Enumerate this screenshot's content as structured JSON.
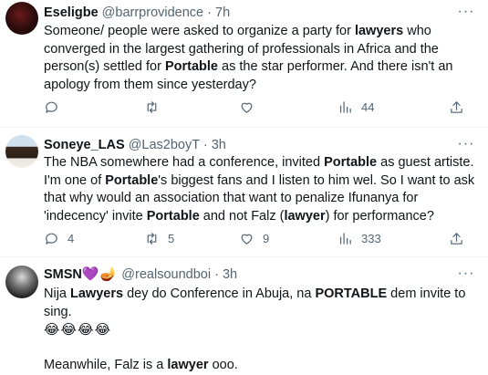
{
  "tweets": [
    {
      "name": "Eseligbe",
      "handle": "@barrprovidence",
      "separator": "·",
      "time": "7h",
      "more": "···",
      "lines": [
        [
          [
            "Someone/ people were asked to organize a party for ",
            false
          ],
          [
            "lawyers",
            true
          ],
          [
            " who",
            false
          ]
        ],
        [
          [
            "converged in the largest gathering of professionals in Africa and the",
            false
          ]
        ],
        [
          [
            "person(s) settled for ",
            false
          ],
          [
            "Portable",
            true
          ],
          [
            " as the star performer. And there isn't an",
            false
          ]
        ],
        [
          [
            "apology from them since yesterday?",
            false
          ]
        ]
      ],
      "counts": {
        "reply": "",
        "retweet": "",
        "like": "",
        "views": "44"
      }
    },
    {
      "name": "Soneye_LAS",
      "handle": "@Las2boyT",
      "separator": "·",
      "time": "3h",
      "more": "···",
      "lines": [
        [
          [
            "The NBA somewhere had a conference, invited ",
            false
          ],
          [
            "Portable",
            true
          ],
          [
            " as guest artiste.",
            false
          ]
        ],
        [
          [
            "I'm one of ",
            false
          ],
          [
            "Portable",
            true
          ],
          [
            "'s biggest fans and I listen to him wel. So I want to ask",
            false
          ]
        ],
        [
          [
            "that why would an association that want to penalize Ifunanya for",
            false
          ]
        ],
        [
          [
            "'indecency' invite ",
            false
          ],
          [
            "Portable",
            true
          ],
          [
            " and not Falz (",
            false
          ],
          [
            "lawyer",
            true
          ],
          [
            ") for performance?",
            false
          ]
        ]
      ],
      "counts": {
        "reply": "4",
        "retweet": "5",
        "like": "9",
        "views": "333"
      }
    },
    {
      "name": "SMSN",
      "name_emoji": "💜🪔",
      "handle": "@realsoundboi",
      "separator": "·",
      "time": "3h",
      "more": "···",
      "lines": [
        [
          [
            "Nija ",
            false
          ],
          [
            "Lawyers",
            true
          ],
          [
            " dey do Conference in Abuja, na ",
            false
          ],
          [
            "PORTABLE",
            true
          ],
          [
            " dem invite to",
            false
          ]
        ],
        [
          [
            "sing.",
            false
          ]
        ],
        [
          [
            "😂😂😂😂",
            false
          ]
        ],
        [
          [
            "",
            false
          ]
        ],
        [
          [
            "Meanwhile, Falz is a ",
            false
          ],
          [
            "lawyer",
            true
          ],
          [
            " ooo.",
            false
          ]
        ]
      ]
    }
  ],
  "colors": {
    "text": "#0f1419",
    "muted": "#536471",
    "divider": "#eff3f4"
  }
}
